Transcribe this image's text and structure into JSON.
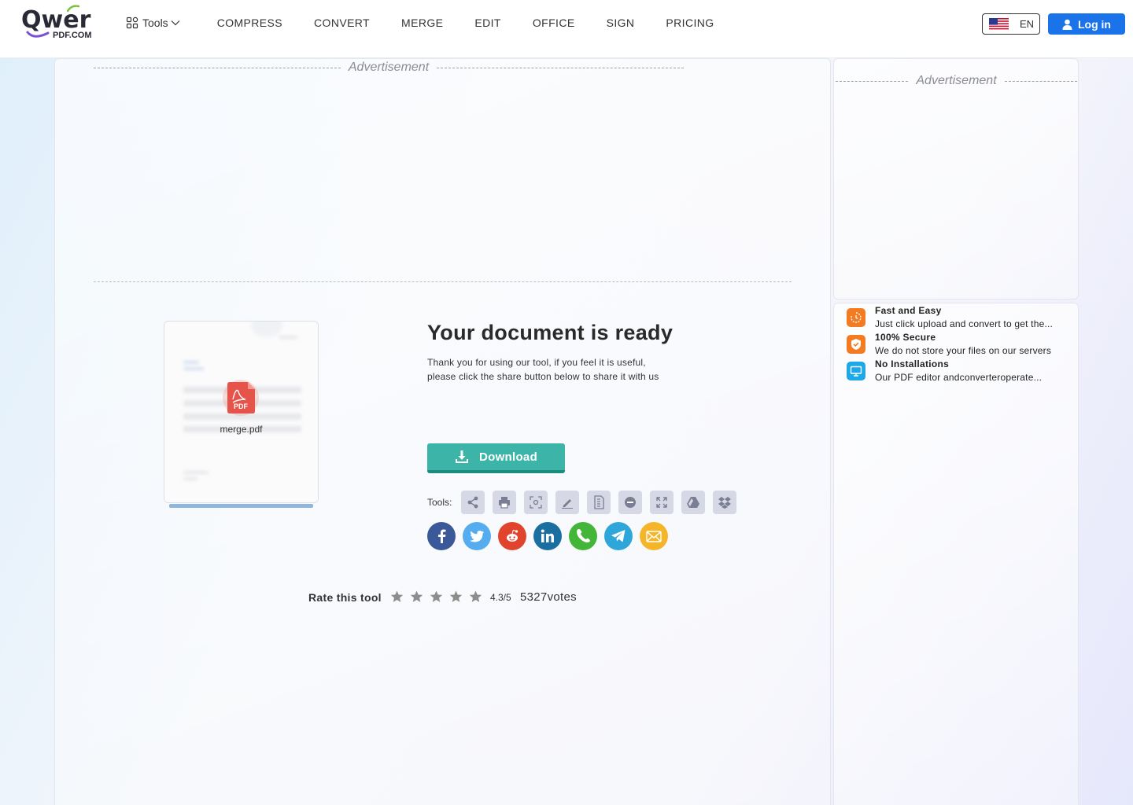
{
  "header": {
    "logo_text": "Qwer",
    "logo_sub": "PDF.COM",
    "tools_label": "Tools",
    "nav_items": [
      "COMPRESS",
      "CONVERT",
      "MERGE",
      "EDIT",
      "OFFICE",
      "SIGN",
      "PRICING"
    ],
    "language": "EN",
    "login_label": "Log in",
    "colors": {
      "login_bg": "#1a73e8"
    }
  },
  "ads": {
    "main_label": "Advertisement",
    "side_label": "Advertisement"
  },
  "features": [
    {
      "icon": "clock-icon",
      "title": "Fast and Easy",
      "desc": "Just click upload and convert to get the...",
      "color": "#f37b21"
    },
    {
      "icon": "shield-icon",
      "title": "100% Secure",
      "desc": "We do not store your files on our servers",
      "color": "#f37b21"
    },
    {
      "icon": "monitor-icon",
      "title": "No Installations",
      "desc": "Our PDF editor andconverteroperate...",
      "color": "#1fa8e8"
    }
  ],
  "document": {
    "file_name": "merge.pdf",
    "pdf_icon_label": "PDF"
  },
  "result": {
    "title": "Your document is ready",
    "desc_line1": "Thank you for using our tool, if you feel it is useful,",
    "desc_line2": "please click the share button below to share it with us",
    "download_label": "Download",
    "colors": {
      "download_bg": "#3db4a8"
    }
  },
  "tools": {
    "label": "Tools:",
    "items": [
      "share-icon",
      "print-icon",
      "preview-icon",
      "edit-icon",
      "compress-icon",
      "delete-icon",
      "fullscreen-icon",
      "google-drive-icon",
      "dropbox-icon"
    ]
  },
  "share": {
    "items": [
      {
        "name": "facebook-icon",
        "color": "#3b5998"
      },
      {
        "name": "twitter-icon",
        "color": "#55acee"
      },
      {
        "name": "reddit-icon",
        "color": "#e0442c"
      },
      {
        "name": "linkedin-icon",
        "color": "#1a6fa0"
      },
      {
        "name": "whatsapp-icon",
        "color": "#43b539"
      },
      {
        "name": "telegram-icon",
        "color": "#2ea6d9"
      },
      {
        "name": "email-icon",
        "color": "#f5b528"
      }
    ]
  },
  "rating": {
    "label": "Rate this tool",
    "stars": 5,
    "score": "4.3/5",
    "votes": "5327votes"
  }
}
